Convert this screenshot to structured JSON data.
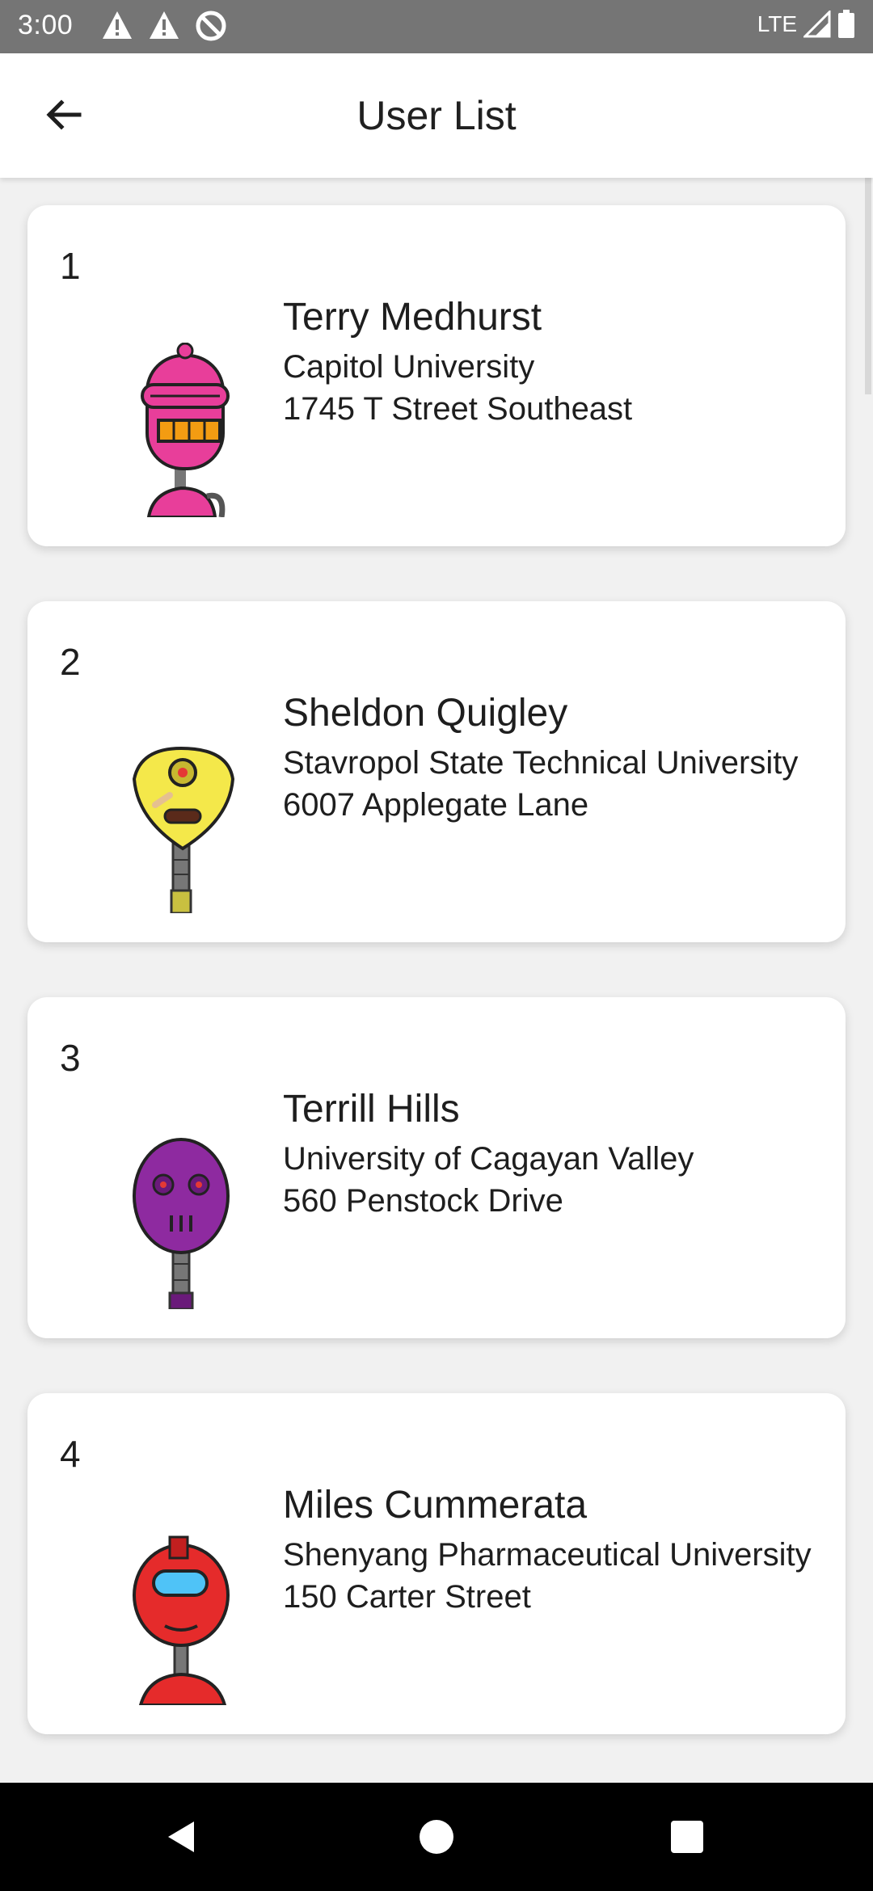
{
  "status_bar": {
    "time": "3:00",
    "left_icons": [
      "warning-icon",
      "warning-icon",
      "no-sim-icon"
    ],
    "network": "LTE",
    "right_icons": [
      "signal-icon",
      "battery-icon"
    ]
  },
  "app_bar": {
    "title": "User List",
    "back_icon": "arrow-left-icon"
  },
  "users": [
    {
      "index": "1",
      "name": "Terry Medhurst",
      "university": "Capitol University",
      "address": "1745 T Street Southeast",
      "avatar_color": "#e83e9a"
    },
    {
      "index": "2",
      "name": "Sheldon Quigley",
      "university": "Stavropol State Technical University",
      "address": "6007 Applegate Lane",
      "avatar_color": "#f4e84a"
    },
    {
      "index": "3",
      "name": "Terrill Hills",
      "university": "University of Cagayan Valley",
      "address": "560 Penstock Drive",
      "avatar_color": "#8e2aa0"
    },
    {
      "index": "4",
      "name": "Miles Cummerata",
      "university": "Shenyang Pharmaceutical University",
      "address": "150 Carter Street",
      "avatar_color": "#e52b2b"
    }
  ],
  "nav_bar": {
    "back": "nav-back-icon",
    "home": "nav-home-icon",
    "recents": "nav-recents-icon"
  }
}
